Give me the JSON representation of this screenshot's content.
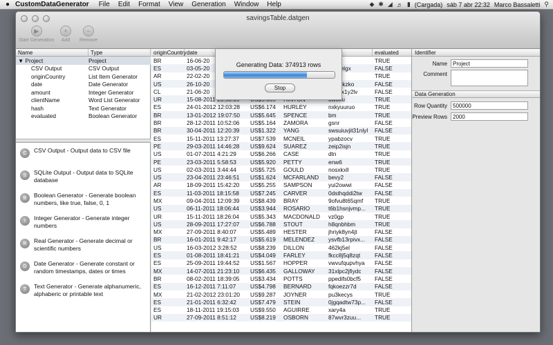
{
  "menubar": {
    "apple": "",
    "app_name": "CustomDataGenerator",
    "items": [
      "File",
      "Edit",
      "Format",
      "View",
      "Generation",
      "Window",
      "Help"
    ],
    "battery": "(Cargada)",
    "clock": "sáb 7 abr  22:32",
    "user": "Marco Bassaletti"
  },
  "window": {
    "title": "savingsTable.datgen",
    "toolbar": {
      "start": "Start Generation",
      "add": "Add",
      "remove": "Remove"
    }
  },
  "tree": {
    "headers": [
      "Name",
      "Type"
    ],
    "rows": [
      {
        "name": "▼ Project",
        "type": "Project"
      },
      {
        "name": "CSV Output",
        "type": "CSV Output"
      },
      {
        "name": "originCountry",
        "type": "List Item Generator"
      },
      {
        "name": "date",
        "type": "Date Generator"
      },
      {
        "name": "amount",
        "type": "Integer Generator"
      },
      {
        "name": "clientName",
        "type": "Word List Generator"
      },
      {
        "name": "hash",
        "type": "Text Generator"
      },
      {
        "name": "evaluated",
        "type": "Boolean Generator"
      }
    ]
  },
  "library": [
    {
      "badge": "C",
      "text": "CSV Output - Output data to CSV file"
    },
    {
      "badge": "S",
      "text": "SQLite Output - Output data to SQLite database"
    },
    {
      "badge": "B",
      "text": "Boolean Generator - Generate boolean numbers, like true, false, 0, 1"
    },
    {
      "badge": "I",
      "text": "Integer Generator - Generate integer numbers"
    },
    {
      "badge": "R",
      "text": "Real Generator - Generate decimal or scientific numbers"
    },
    {
      "badge": "D",
      "text": "Date Generator - Generate constant or random timestamps, dates or times"
    },
    {
      "badge": "T",
      "text": "Text Generator - Generate alphanumeric, alphaberic or printable text"
    }
  ],
  "table": {
    "headers": [
      "originCountry",
      "date",
      "",
      "",
      "",
      "evaluated"
    ],
    "rows": [
      [
        "BR",
        "16-06-20",
        "",
        "",
        "",
        "TRUE"
      ],
      [
        "ES",
        "03-05-20",
        "",
        "",
        "2gzvelgx",
        "FALSE"
      ],
      [
        "AR",
        "22-02-20",
        "",
        "",
        "5",
        "TRUE"
      ],
      [
        "US",
        "26-10-20",
        "",
        "",
        "8gidukzko",
        "FALSE"
      ],
      [
        "CL",
        "21-06-20",
        "",
        "",
        "m0urx1y2lv",
        "FALSE"
      ],
      [
        "UR",
        "15-08-2011 23:53:09",
        "US$5.665",
        "HINTON",
        "3woku",
        "TRUE"
      ],
      [
        "ES",
        "24-01-2012 12:03:28",
        "US$6.174",
        "HURLEY",
        "nxkyuuruo",
        "TRUE"
      ],
      [
        "BR",
        "13-01-2012 19:07:50",
        "US$5.645",
        "SPENCE",
        "bm",
        "TRUE"
      ],
      [
        "BR",
        "28-12-2011 10:52:06",
        "US$5.164",
        "ZAMORA",
        "gsnr",
        "FALSE"
      ],
      [
        "BR",
        "30-04-2011 12:20:39",
        "US$1.322",
        "YANG",
        "swsuiuvjit31nlyl",
        "FALSE"
      ],
      [
        "ES",
        "15-11-2011 13:27:37",
        "US$7.539",
        "MCNEIL",
        "ypabzocv",
        "TRUE"
      ],
      [
        "PE",
        "29-03-2011 14:46:28",
        "US$9.624",
        "SUAREZ",
        "zeip2isjn",
        "TRUE"
      ],
      [
        "US",
        "01-07-2011 4:21:29",
        "US$6.266",
        "CASE",
        "dtn",
        "TRUE"
      ],
      [
        "PE",
        "23-03-2011 5:58:53",
        "US$5.920",
        "PETTY",
        "enw6",
        "TRUE"
      ],
      [
        "US",
        "02-03-2011 3:44:44",
        "US$5.725",
        "GOULD",
        "nosxkxll",
        "TRUE"
      ],
      [
        "US",
        "23-04-2011 23:46:51",
        "US$1.624",
        "MCFARLAND",
        "bevy2",
        "FALSE"
      ],
      [
        "AR",
        "18-09-2011 15:42:20",
        "US$5.255",
        "SAMPSON",
        "yui2owwi",
        "FALSE"
      ],
      [
        "ES",
        "11-03-2011 18:15:58",
        "US$7.245",
        "CARVER",
        "0dsthqddi2tw",
        "FALSE"
      ],
      [
        "MX",
        "09-04-2011 12:09:39",
        "US$8.439",
        "BRAY",
        "9ofvu8t65qmf",
        "TRUE"
      ],
      [
        "US",
        "06-11-2011 18:06:44",
        "US$3.944",
        "ROSARIO",
        "t6b1hsnjvmp...",
        "TRUE"
      ],
      [
        "UR",
        "15-11-2011 18:26:04",
        "US$5.343",
        "MACDONALD",
        "vz0gp",
        "TRUE"
      ],
      [
        "US",
        "28-09-2011 17:27:07",
        "US$6.788",
        "STOUT",
        "h8qnbhbm",
        "TRUE"
      ],
      [
        "MX",
        "27-09-2011 8:40:07",
        "US$5.489",
        "HESTER",
        "jhriyk8yn4jt",
        "FALSE"
      ],
      [
        "BR",
        "16-01-2011 9:42:17",
        "US$5.619",
        "MELENDEZ",
        "ysvfb13rpivx...",
        "FALSE"
      ],
      [
        "US",
        "16-03-2012 3:28:52",
        "US$8.239",
        "DILLON",
        "462kj5el",
        "FALSE"
      ],
      [
        "ES",
        "01-08-2011 18:41:21",
        "US$4.049",
        "FARLEY",
        "fkcc8j5q8zqt",
        "FALSE"
      ],
      [
        "ES",
        "25-09-2011 19:44:52",
        "US$1.567",
        "HOPPER",
        "vwvufqupvhya",
        "FALSE"
      ],
      [
        "MX",
        "14-07-2011 21:23:10",
        "US$6.435",
        "GALLOWAY",
        "31xlpc2jfiydc",
        "FALSE"
      ],
      [
        "BR",
        "08-02-2011 18:39:05",
        "US$3.434",
        "POTTS",
        "ppedifs0bcf5",
        "FALSE"
      ],
      [
        "ES",
        "16-12-2011 7:11:07",
        "US$4.798",
        "BERNARD",
        "fqkoezzr7d",
        "FALSE"
      ],
      [
        "MX",
        "21-02-2012 23:01:20",
        "US$9.287",
        "JOYNER",
        "pu3kecys",
        "TRUE"
      ],
      [
        "ES",
        "21-01-2011 6:32:42",
        "US$7.479",
        "STEIN",
        "0jgqadtw73p...",
        "FALSE"
      ],
      [
        "ES",
        "18-11-2011 19:15:03",
        "US$9.550",
        "AGUIRRE",
        "xary4a",
        "TRUE"
      ],
      [
        "UR",
        "27-09-2011 8:51:12",
        "US$8.219",
        "OSBORN",
        "87wvr3zuu...",
        "TRUE"
      ]
    ]
  },
  "properties": {
    "identifier": {
      "section": "Identifier",
      "name_label": "Name",
      "name_value": "Project",
      "comment_label": "Comment",
      "comment_value": ""
    },
    "generation": {
      "section": "Data Generation",
      "row_label": "Row Quantity",
      "row_value": "500000",
      "preview_label": "Preview Rows",
      "preview_value": "2000"
    }
  },
  "dialog": {
    "message": "Generating Data: 374913 rows",
    "progress": 0.75,
    "stop": "Stop"
  },
  "colors": {
    "accent": "#3a7fd0",
    "selection": "#d9dee6",
    "row_alt": "#eef2f7"
  }
}
